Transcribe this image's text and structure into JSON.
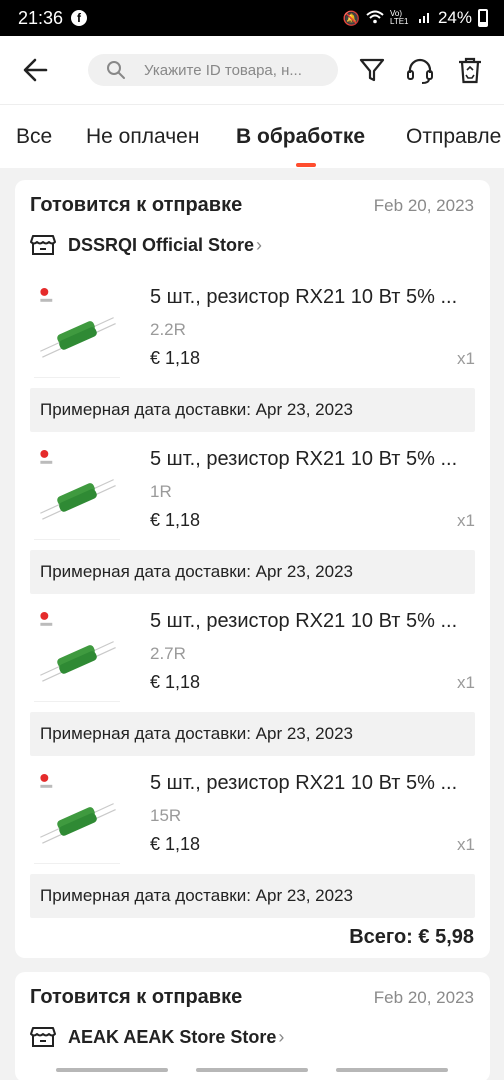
{
  "status_bar": {
    "time": "21:36",
    "battery": "24%",
    "network_label": "Vo) LTE1"
  },
  "search": {
    "placeholder": "Укажите ID товара, н..."
  },
  "tabs": [
    {
      "label": "Все"
    },
    {
      "label": "Не оплачен"
    },
    {
      "label": "В обработке",
      "active": true
    },
    {
      "label": "Отправле"
    }
  ],
  "colors": {
    "accent": "#ff4d2e",
    "background": "#f2f2f2"
  },
  "orders": [
    {
      "status": "Готовится к отправке",
      "date": "Feb 20, 2023",
      "store": "DSSRQI Official Store",
      "items": [
        {
          "title": "5 шт., резистор RX21 10 Вт 5% ...",
          "variant": "2.2R",
          "price": "€ 1,18",
          "qty": "x1",
          "delivery": "Примерная дата доставки: Apr 23, 2023"
        },
        {
          "title": "5 шт., резистор RX21 10 Вт 5% ...",
          "variant": "1R",
          "price": "€ 1,18",
          "qty": "x1",
          "delivery": "Примерная дата доставки: Apr 23, 2023"
        },
        {
          "title": "5 шт., резистор RX21 10 Вт 5% ...",
          "variant": "2.7R",
          "price": "€ 1,18",
          "qty": "x1",
          "delivery": "Примерная дата доставки: Apr 23, 2023"
        },
        {
          "title": "5 шт., резистор RX21 10 Вт 5% ...",
          "variant": "15R",
          "price": "€ 1,18",
          "qty": "x1",
          "delivery": "Примерная дата доставки: Apr 23, 2023"
        }
      ],
      "total": "Всего: € 5,98"
    },
    {
      "status": "Готовится к отправке",
      "date": "Feb 20, 2023",
      "store": "AEAK AEAK Store Store"
    }
  ]
}
